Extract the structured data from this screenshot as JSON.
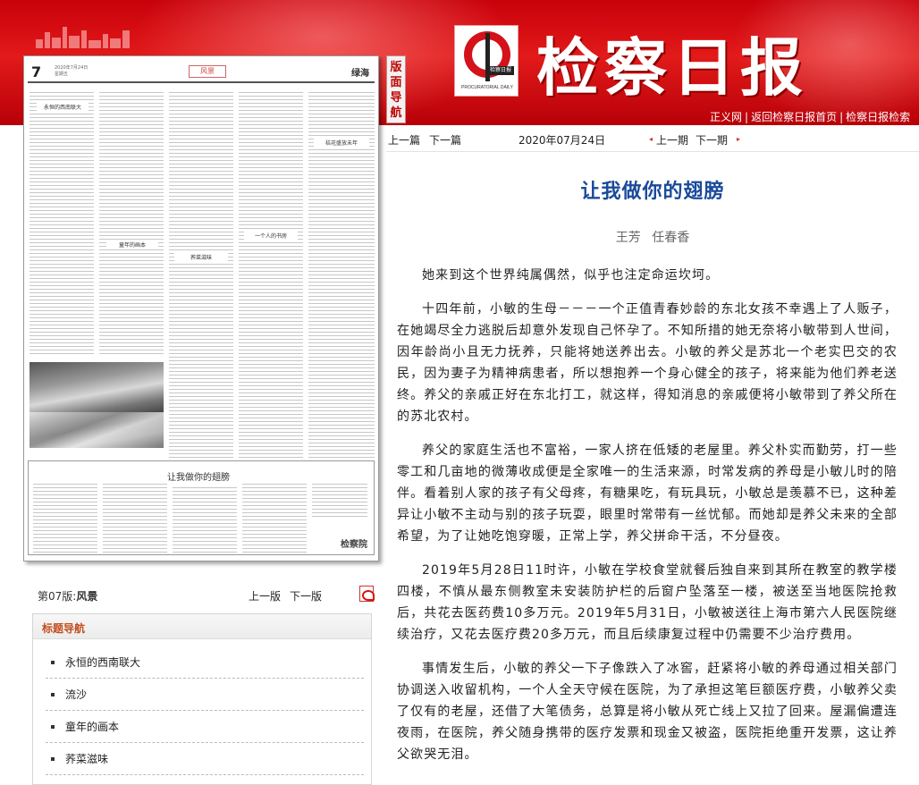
{
  "header": {
    "masthead": "检察日报",
    "logo_caption": "检察日报",
    "logo_english": "PROCURATORIAL DAILY",
    "layout_nav_label": "版面导航",
    "links": [
      "正义网",
      "返回检察日报首页",
      "检察日报检索"
    ]
  },
  "thumbnail": {
    "page_number": "7",
    "meta_line1": "2020年7月24日",
    "meta_line2": "星期五",
    "section_tag": "风景",
    "column_label": "绿海",
    "feature_title": "让我做你的翅膀",
    "stamp": "检察院",
    "titles": [
      "永恒的西南联大",
      "童年的画本",
      "荞菜滋味",
      "一个人的书房",
      "桔花盛放未年"
    ]
  },
  "page_nav": {
    "page_label_prefix": "第07版:",
    "page_label_name": "风景",
    "prev_page": "上一版",
    "next_page": "下一版"
  },
  "title_nav": {
    "header": "标题导航",
    "items": [
      "永恒的西南联大",
      "流沙",
      "童年的画本",
      "荞菜滋味"
    ]
  },
  "article_nav": {
    "prev_article": "上一篇",
    "next_article": "下一篇",
    "date": "2020年07月24日",
    "prev_issue": "上一期",
    "next_issue": "下一期"
  },
  "article": {
    "title": "让我做你的翅膀",
    "author": "王芳 任春香",
    "paragraphs": [
      "她来到这个世界纯属偶然，似乎也注定命运坎坷。",
      "十四年前，小敏的生母－－－一个正值青春妙龄的东北女孩不幸遇上了人贩子，在她竭尽全力逃脱后却意外发现自己怀孕了。不知所措的她无奈将小敏带到人世间，因年龄尚小且无力抚养，只能将她送养出去。小敏的养父是苏北一个老实巴交的农民，因为妻子为精神病患者，所以想抱养一个身心健全的孩子，将来能为他们养老送终。养父的亲戚正好在东北打工，就这样，得知消息的亲戚便将小敏带到了养父所在的苏北农村。",
      "养父的家庭生活也不富裕，一家人挤在低矮的老屋里。养父朴实而勤劳，打一些零工和几亩地的微薄收成便是全家唯一的生活来源，时常发病的养母是小敏儿时的陪伴。看着别人家的孩子有父母疼，有糖果吃，有玩具玩，小敏总是羡慕不已，这种差异让小敏不主动与别的孩子玩耍，眼里时常带有一丝忧郁。而她却是养父未来的全部希望，为了让她吃饱穿暖，正常上学，养父拼命干活，不分昼夜。",
      "2019年5月28日11时许，小敏在学校食堂就餐后独自来到其所在教室的教学楼四楼，不慎从最东侧教室未安装防护栏的后窗户坠落至一楼，被送至当地医院抢救后，共花去医药费10多万元。2019年5月31日，小敏被送往上海市第六人民医院继续治疗，又花去医疗费20多万元，而且后续康复过程中仍需要不少治疗费用。",
      "事情发生后，小敏的养父一下子像跌入了冰窖，赶紧将小敏的养母通过相关部门协调送入收留机构，一个人全天守候在医院，为了承担这笔巨额医疗费，小敏养父卖了仅有的老屋，还借了大笔债务，总算是将小敏从死亡线上又拉了回来。屋漏偏遭连夜雨，在医院，养父随身携带的医疗发票和现金又被盗，医院拒绝重开发票，这让养父欲哭无泪。"
    ]
  }
}
